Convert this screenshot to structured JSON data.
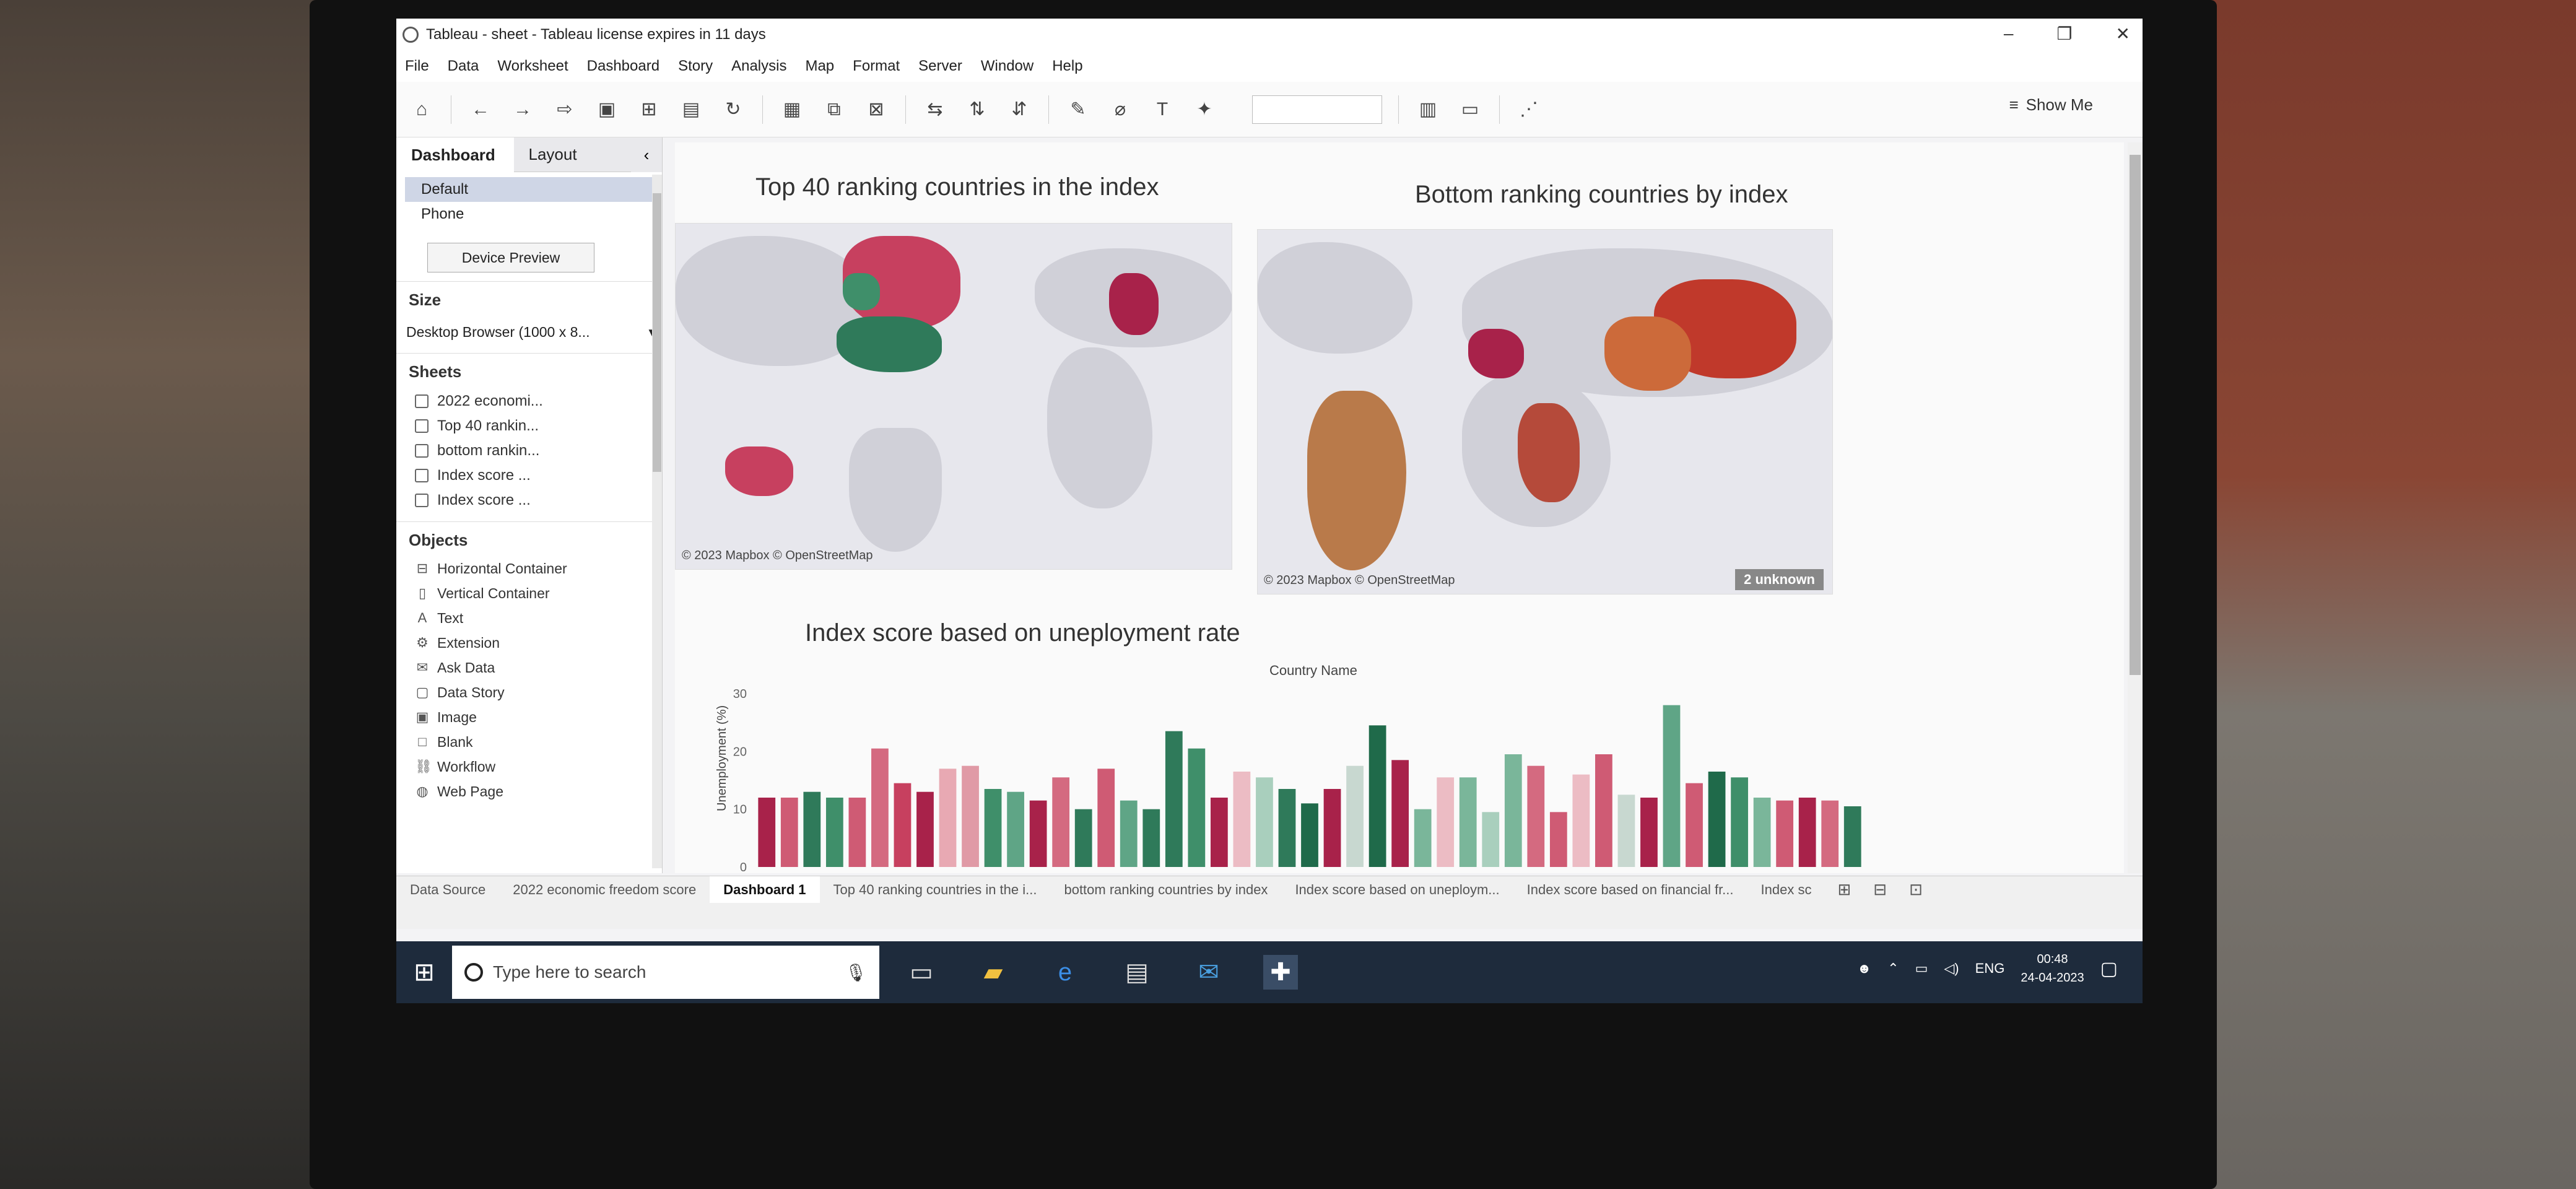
{
  "window": {
    "title": "Tableau - sheet - Tableau license expires in 11 days"
  },
  "menu": [
    "File",
    "Data",
    "Worksheet",
    "Dashboard",
    "Story",
    "Analysis",
    "Map",
    "Format",
    "Server",
    "Window",
    "Help"
  ],
  "toolbar": {
    "show_me": "Show Me"
  },
  "left_pane": {
    "tabs": [
      "Dashboard",
      "Layout"
    ],
    "devices": [
      "Default",
      "Phone"
    ],
    "device_preview": "Device Preview",
    "size_header": "Size",
    "size_value": "Desktop Browser (1000 x 8...",
    "sheets_header": "Sheets",
    "sheets": [
      "2022 economi...",
      "Top 40 rankin...",
      "bottom rankin...",
      "Index score ...",
      "Index score ..."
    ],
    "objects_header": "Objects",
    "objects": [
      {
        "icon": "horizontal-container-icon",
        "label": "Horizontal Container"
      },
      {
        "icon": "vertical-container-icon",
        "label": "Vertical Container"
      },
      {
        "icon": "text-icon",
        "label": "Text"
      },
      {
        "icon": "extension-icon",
        "label": "Extension"
      },
      {
        "icon": "ask-data-icon",
        "label": "Ask Data"
      },
      {
        "icon": "data-story-icon",
        "label": "Data Story"
      },
      {
        "icon": "image-icon",
        "label": "Image"
      },
      {
        "icon": "blank-icon",
        "label": "Blank"
      },
      {
        "icon": "workflow-icon",
        "label": "Workflow"
      },
      {
        "icon": "web-page-icon",
        "label": "Web Page"
      }
    ]
  },
  "dashboard": {
    "map1_title": "Top 40 ranking  countries in the index",
    "map2_title": "Bottom ranking countries by index",
    "map_attribution": "© 2023 Mapbox © OpenStreetMap",
    "unknown_badge": "2 unknown",
    "bar_title": "Index score based on uneployment rate",
    "bar_header": "Country Name"
  },
  "chart_data": {
    "type": "bar",
    "title": "Index score based on uneployment rate",
    "xlabel": "Country Name",
    "ylabel": "Unemployment (%)",
    "ylim": [
      0,
      30
    ],
    "yticks": [
      0,
      10,
      20,
      30
    ],
    "values": [
      12,
      12,
      13,
      12,
      12,
      20.5,
      14.5,
      13,
      17,
      17.5,
      13.5,
      13,
      11.5,
      15.5,
      10,
      17,
      11.5,
      10,
      23.5,
      20.5,
      12,
      16.5,
      15.5,
      13.5,
      11,
      13.5,
      17.5,
      24.5,
      18.5,
      10,
      15.5,
      15.5,
      9.5,
      19.5,
      17.5,
      9.5,
      16,
      19.5,
      12.5,
      12,
      28,
      14.5,
      16.5,
      15.5,
      12,
      11.5,
      12,
      11.5,
      10.5
    ],
    "colors": [
      "#a8224a",
      "#cf5b74",
      "#2f7a5a",
      "#3f8f6a",
      "#cf5b74",
      "#d46a80",
      "#c7405f",
      "#a8224a",
      "#e8a9b3",
      "#e09aa6",
      "#3f8f6a",
      "#5fa586",
      "#a8224a",
      "#d46a80",
      "#2f7a5a",
      "#cf5b74",
      "#5fa586",
      "#2f7a5a",
      "#2f7a5a",
      "#3f8f6a",
      "#a8224a",
      "#ecbcc4",
      "#a9cfbd",
      "#2f7a5a",
      "#1f6a4a",
      "#a8224a",
      "#c8d8d0",
      "#1f6a4a",
      "#a8224a",
      "#7ab69a",
      "#ecbcc4",
      "#7ab69a",
      "#a9cfbd",
      "#7ab69a",
      "#d46a80",
      "#cf5b74",
      "#ecbcc4",
      "#cf5b74",
      "#c8d8d0",
      "#a8224a",
      "#5fa586",
      "#cf5b74",
      "#1f6a4a",
      "#3f8f6a",
      "#7ab69a",
      "#cf5b74",
      "#a8224a",
      "#d46a80",
      "#2f7a5a"
    ]
  },
  "sheet_tabs": [
    "Data Source",
    "2022 economic freedom score",
    "Dashboard 1",
    "Top 40 ranking countries in the i...",
    "bottom ranking countries by index",
    "Index score based on uneploym...",
    "Index score based on financial fr...",
    "Index sc"
  ],
  "taskbar": {
    "search_placeholder": "Type here to search",
    "language": "ENG",
    "time": "00:48",
    "date": "24-04-2023"
  }
}
